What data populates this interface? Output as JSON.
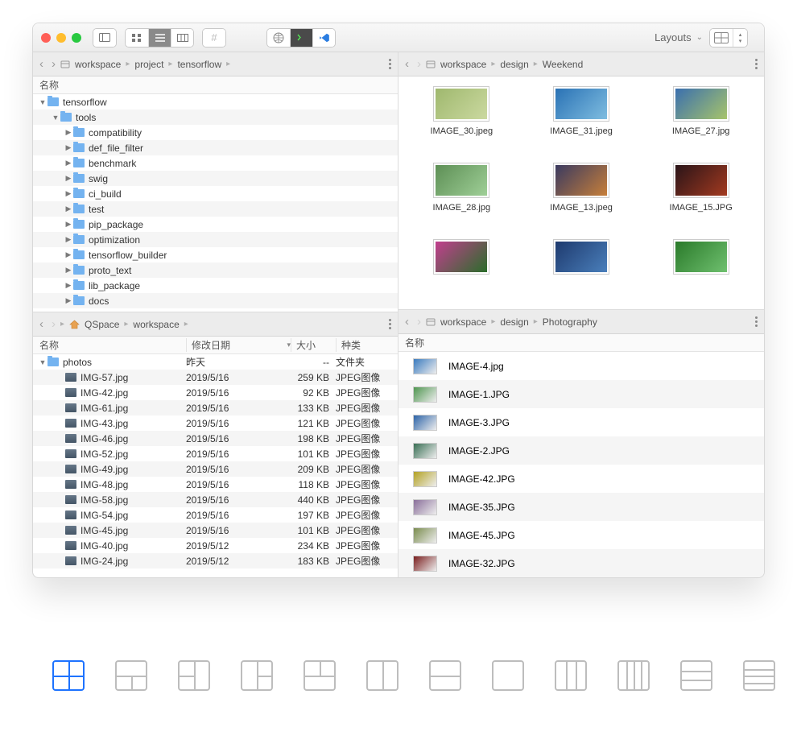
{
  "titlebar": {
    "layouts_label": "Layouts"
  },
  "paneA_top": {
    "crumbs": [
      "workspace",
      "project",
      "tensorflow"
    ],
    "col_name": "名称",
    "tree": [
      {
        "depth": 1,
        "open": true,
        "label": "tensorflow"
      },
      {
        "depth": 2,
        "open": true,
        "label": "tools"
      },
      {
        "depth": 3,
        "open": false,
        "label": "compatibility"
      },
      {
        "depth": 3,
        "open": false,
        "label": "def_file_filter"
      },
      {
        "depth": 3,
        "open": false,
        "label": "benchmark"
      },
      {
        "depth": 3,
        "open": false,
        "label": "swig"
      },
      {
        "depth": 3,
        "open": false,
        "label": "ci_build"
      },
      {
        "depth": 3,
        "open": false,
        "label": "test"
      },
      {
        "depth": 3,
        "open": false,
        "label": "pip_package"
      },
      {
        "depth": 3,
        "open": false,
        "label": "optimization"
      },
      {
        "depth": 3,
        "open": false,
        "label": "tensorflow_builder"
      },
      {
        "depth": 3,
        "open": false,
        "label": "proto_text"
      },
      {
        "depth": 3,
        "open": false,
        "label": "lib_package"
      },
      {
        "depth": 3,
        "open": false,
        "label": "docs"
      }
    ]
  },
  "paneA_bottom": {
    "crumbs_home": "QSpace",
    "crumbs": [
      "workspace"
    ],
    "cols": {
      "name": "名称",
      "date": "修改日期",
      "size": "大小",
      "kind": "种类"
    },
    "rows": [
      {
        "name": "photos",
        "date": "昨天",
        "size": "--",
        "kind": "文件夹",
        "folder": true,
        "open": true
      },
      {
        "name": "IMG-57.jpg",
        "date": "2019/5/16",
        "size": "259 KB",
        "kind": "JPEG图像"
      },
      {
        "name": "IMG-42.jpg",
        "date": "2019/5/16",
        "size": "92 KB",
        "kind": "JPEG图像"
      },
      {
        "name": "IMG-61.jpg",
        "date": "2019/5/16",
        "size": "133 KB",
        "kind": "JPEG图像"
      },
      {
        "name": "IMG-43.jpg",
        "date": "2019/5/16",
        "size": "121 KB",
        "kind": "JPEG图像"
      },
      {
        "name": "IMG-46.jpg",
        "date": "2019/5/16",
        "size": "198 KB",
        "kind": "JPEG图像"
      },
      {
        "name": "IMG-52.jpg",
        "date": "2019/5/16",
        "size": "101 KB",
        "kind": "JPEG图像"
      },
      {
        "name": "IMG-49.jpg",
        "date": "2019/5/16",
        "size": "209 KB",
        "kind": "JPEG图像"
      },
      {
        "name": "IMG-48.jpg",
        "date": "2019/5/16",
        "size": "118 KB",
        "kind": "JPEG图像"
      },
      {
        "name": "IMG-58.jpg",
        "date": "2019/5/16",
        "size": "440 KB",
        "kind": "JPEG图像"
      },
      {
        "name": "IMG-54.jpg",
        "date": "2019/5/16",
        "size": "197 KB",
        "kind": "JPEG图像"
      },
      {
        "name": "IMG-45.jpg",
        "date": "2019/5/16",
        "size": "101 KB",
        "kind": "JPEG图像"
      },
      {
        "name": "IMG-40.jpg",
        "date": "2019/5/12",
        "size": "234 KB",
        "kind": "JPEG图像"
      },
      {
        "name": "IMG-24.jpg",
        "date": "2019/5/12",
        "size": "183 KB",
        "kind": "JPEG图像"
      }
    ]
  },
  "paneB": {
    "crumbs": [
      "workspace",
      "design",
      "Weekend"
    ],
    "items": [
      {
        "label": "IMAGE_30.jpeg",
        "c1": "#9fb86e",
        "c2": "#cbd9a0"
      },
      {
        "label": "IMAGE_31.jpeg",
        "c1": "#2a72b5",
        "c2": "#7fbde0"
      },
      {
        "label": "IMAGE_27.jpg",
        "c1": "#3a6fae",
        "c2": "#a7c46a"
      },
      {
        "label": "IMAGE_28.jpg",
        "c1": "#5d8f55",
        "c2": "#9fcf97"
      },
      {
        "label": "IMAGE_13.jpeg",
        "c1": "#3a3a60",
        "c2": "#c77f3a"
      },
      {
        "label": "IMAGE_15.JPG",
        "c1": "#2a1418",
        "c2": "#a33a20"
      },
      {
        "label": "",
        "c1": "#c23e8e",
        "c2": "#2a6d2a"
      },
      {
        "label": "",
        "c1": "#1e3a6e",
        "c2": "#4a7fbb"
      },
      {
        "label": "",
        "c1": "#2a7a2a",
        "c2": "#6fc06f"
      }
    ]
  },
  "paneC": {
    "crumbs": [
      "workspace",
      "design",
      "Photography"
    ],
    "col_name": "名称",
    "rows": [
      {
        "label": "IMAGE-4.jpg",
        "c": "#3b7bbf"
      },
      {
        "label": "IMAGE-1.JPG",
        "c": "#4f9650"
      },
      {
        "label": "IMAGE-3.JPG",
        "c": "#2d64a8"
      },
      {
        "label": "IMAGE-2.JPG",
        "c": "#3a6f55"
      },
      {
        "label": "IMAGE-42.JPG",
        "c": "#b3a224"
      },
      {
        "label": "IMAGE-35.JPG",
        "c": "#8a6f9a"
      },
      {
        "label": "IMAGE-45.JPG",
        "c": "#7a8c4f"
      },
      {
        "label": "IMAGE-32.JPG",
        "c": "#7a1f1f"
      }
    ]
  }
}
